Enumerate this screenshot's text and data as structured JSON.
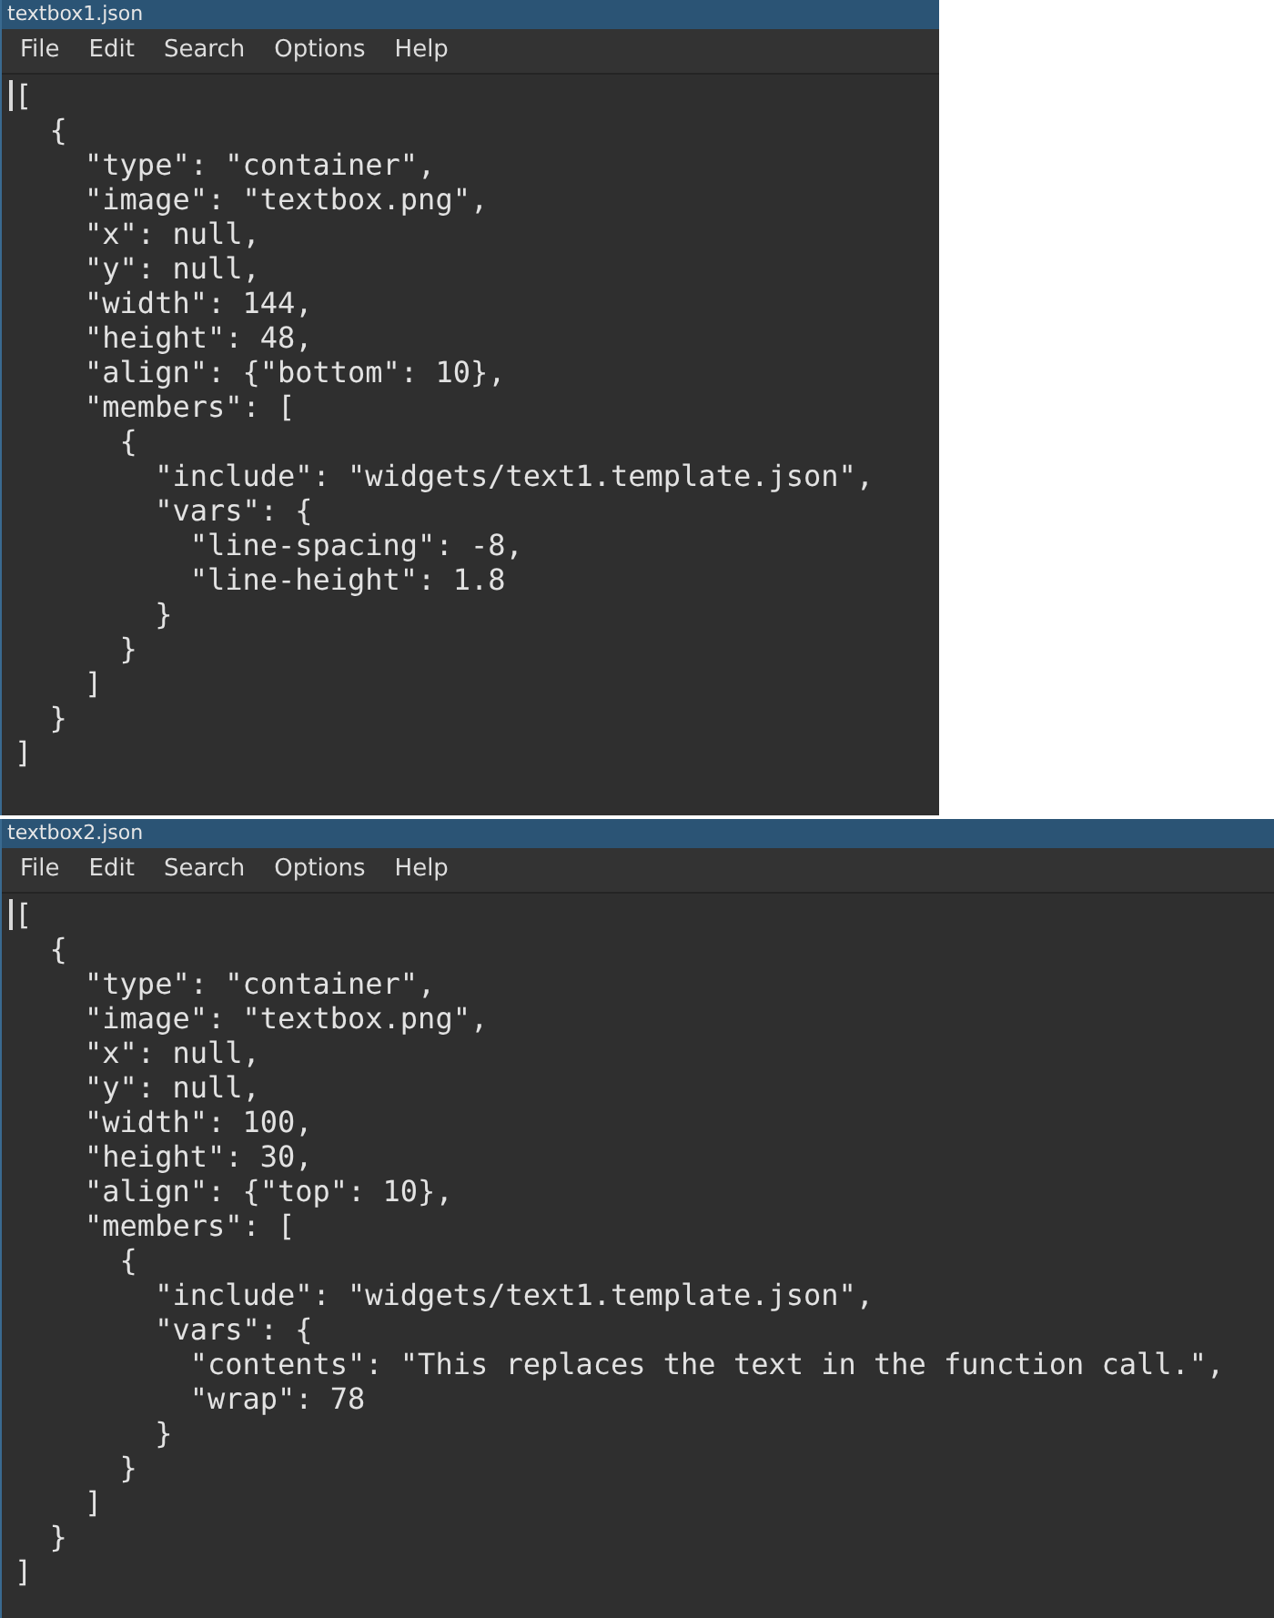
{
  "windows": [
    {
      "title": "textbox1.json",
      "menu": [
        "File",
        "Edit",
        "Search",
        "Options",
        "Help"
      ],
      "lines": [
        "[",
        "  {",
        "    \"type\": \"container\",",
        "    \"image\": \"textbox.png\",",
        "    \"x\": null,",
        "    \"y\": null,",
        "    \"width\": 144,",
        "    \"height\": 48,",
        "    \"align\": {\"bottom\": 10},",
        "    \"members\": [",
        "      {",
        "        \"include\": \"widgets/text1.template.json\",",
        "        \"vars\": {",
        "          \"line-spacing\": -8,",
        "          \"line-height\": 1.8",
        "        }",
        "      }",
        "    ]",
        "  }",
        "]"
      ]
    },
    {
      "title": "textbox2.json",
      "menu": [
        "File",
        "Edit",
        "Search",
        "Options",
        "Help"
      ],
      "lines": [
        "[",
        "  {",
        "    \"type\": \"container\",",
        "    \"image\": \"textbox.png\",",
        "    \"x\": null,",
        "    \"y\": null,",
        "    \"width\": 100,",
        "    \"height\": 30,",
        "    \"align\": {\"top\": 10},",
        "    \"members\": [",
        "      {",
        "        \"include\": \"widgets/text1.template.json\",",
        "        \"vars\": {",
        "          \"contents\": \"This replaces the text in the function call.\",",
        "          \"wrap\": 78",
        "        }",
        "      }",
        "    ]",
        "  }",
        "]"
      ]
    }
  ]
}
